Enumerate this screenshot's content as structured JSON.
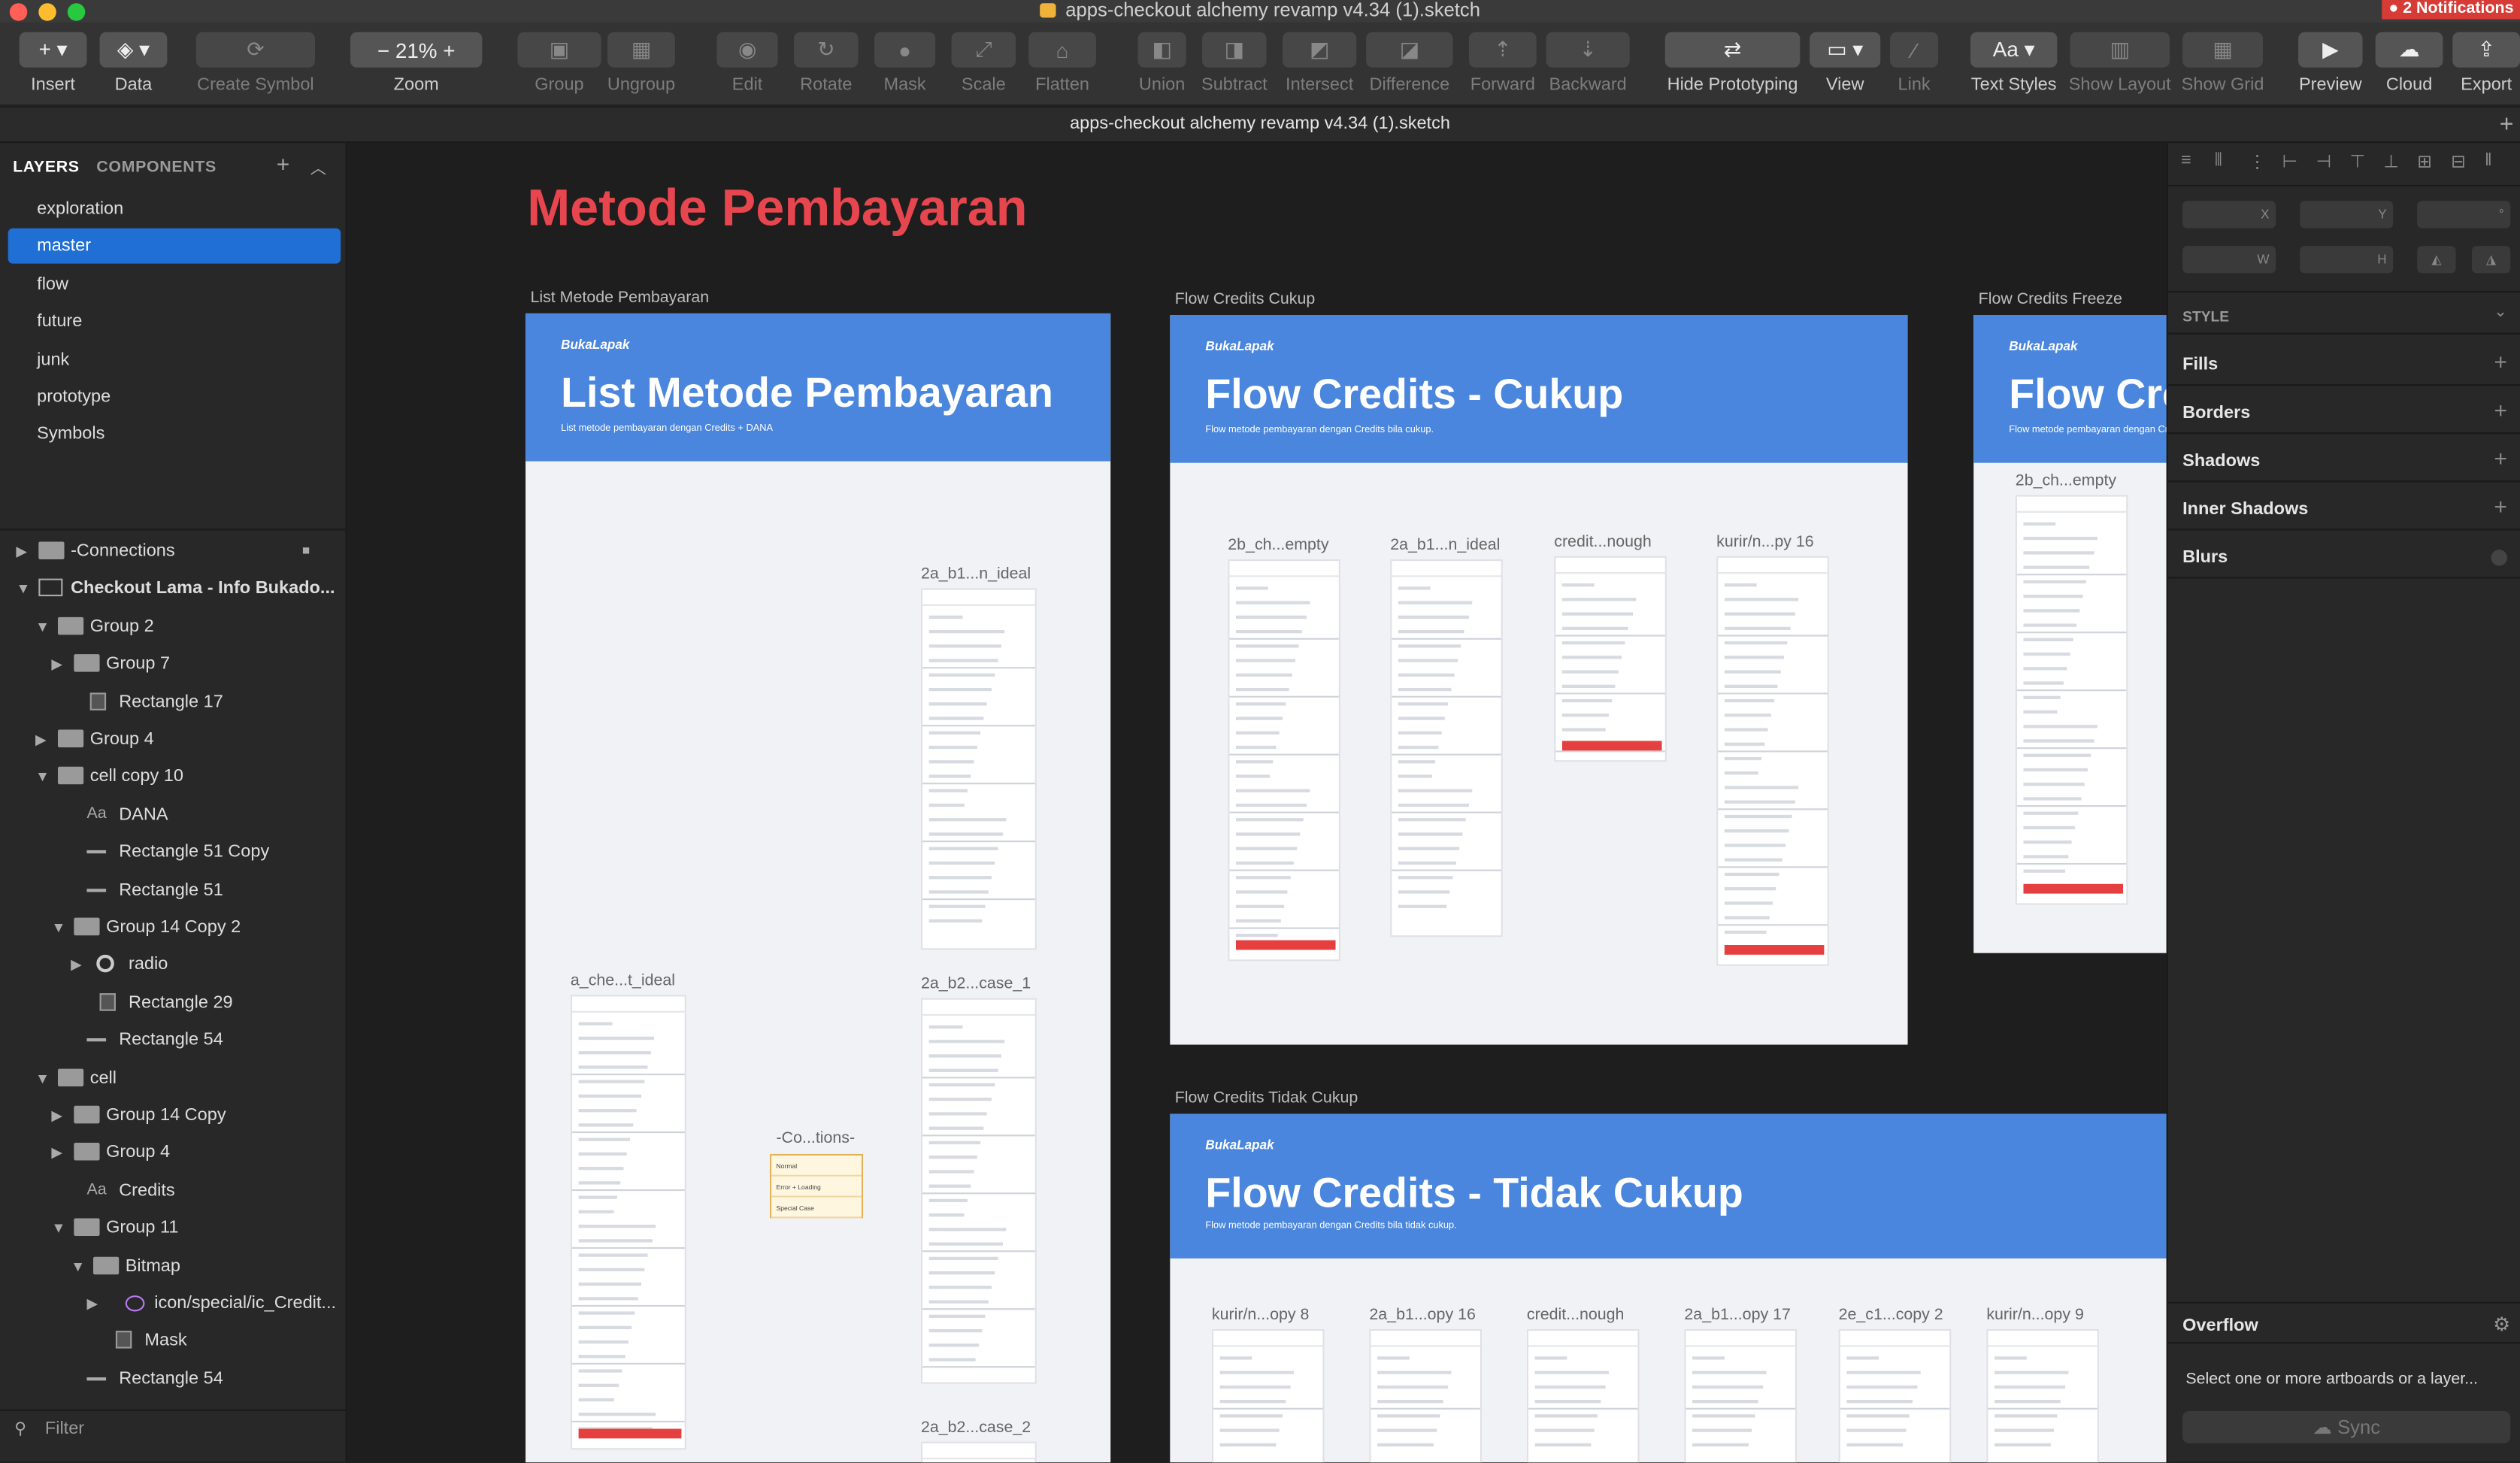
{
  "window": {
    "title": "apps-checkout alchemy revamp v4.34 (1).sketch",
    "notifications": "2 Notifications",
    "document_tab": "apps-checkout alchemy revamp v4.34 (1).sketch"
  },
  "toolbar": {
    "items": [
      {
        "label": "Insert",
        "icon": "+ ▾"
      },
      {
        "label": "Data",
        "icon": "◈ ▾"
      },
      {
        "label": "Create Symbol",
        "icon": "⟳"
      },
      {
        "label": "Zoom",
        "icon": "−  21%  +"
      },
      {
        "label": "Group",
        "icon": "▣"
      },
      {
        "label": "Ungroup",
        "icon": "▦"
      },
      {
        "label": "Edit",
        "icon": "◉"
      },
      {
        "label": "Rotate",
        "icon": "↻"
      },
      {
        "label": "Mask",
        "icon": "●"
      },
      {
        "label": "Scale",
        "icon": "⤢"
      },
      {
        "label": "Flatten",
        "icon": "⌂"
      },
      {
        "label": "Union",
        "icon": "◧"
      },
      {
        "label": "Subtract",
        "icon": "◨"
      },
      {
        "label": "Intersect",
        "icon": "◩"
      },
      {
        "label": "Difference",
        "icon": "◪"
      },
      {
        "label": "Forward",
        "icon": "⇡"
      },
      {
        "label": "Backward",
        "icon": "⇣"
      },
      {
        "label": "Hide Prototyping",
        "icon": "⇄"
      },
      {
        "label": "View",
        "icon": "▭ ▾"
      },
      {
        "label": "Link",
        "icon": "⁄"
      },
      {
        "label": "Text Styles",
        "icon": "Aa ▾"
      },
      {
        "label": "Show Layout",
        "icon": "▥"
      },
      {
        "label": "Show Grid",
        "icon": "▦"
      },
      {
        "label": "Preview",
        "icon": "▶"
      },
      {
        "label": "Cloud",
        "icon": "☁"
      },
      {
        "label": "Export",
        "icon": "⇪"
      }
    ]
  },
  "sidebar": {
    "tabs": [
      "LAYERS",
      "COMPONENTS"
    ],
    "pages": [
      "exploration",
      "master",
      "flow",
      "future",
      "junk",
      "prototype",
      "Symbols"
    ],
    "selected_page": "master",
    "layers": [
      {
        "label": "-Connections",
        "type": "folder",
        "arrow": "▶",
        "locked": true
      },
      {
        "label": "Checkout Lama - Info Bukado...",
        "type": "artboard",
        "arrow": "▼"
      },
      {
        "label": "Group 2",
        "type": "folder",
        "arrow": "▼"
      },
      {
        "label": "Group 7",
        "type": "folder",
        "arrow": "▶"
      },
      {
        "label": "Rectangle 17",
        "type": "rect",
        "arrow": ""
      },
      {
        "label": "Group 4",
        "type": "folder",
        "arrow": "▶"
      },
      {
        "label": "cell copy 10",
        "type": "folder",
        "arrow": "▼"
      },
      {
        "label": "DANA",
        "type": "text",
        "arrow": ""
      },
      {
        "label": "Rectangle 51 Copy",
        "type": "line",
        "arrow": ""
      },
      {
        "label": "Rectangle 51",
        "type": "line",
        "arrow": ""
      },
      {
        "label": "Group 14 Copy 2",
        "type": "folder",
        "arrow": "▼"
      },
      {
        "label": "radio",
        "type": "oval",
        "arrow": "▶"
      },
      {
        "label": "Rectangle 29",
        "type": "rect",
        "arrow": ""
      },
      {
        "label": "Rectangle 54",
        "type": "line",
        "arrow": ""
      },
      {
        "label": "cell",
        "type": "folder",
        "arrow": "▼"
      },
      {
        "label": "Group 14 Copy",
        "type": "folder",
        "arrow": "▶"
      },
      {
        "label": "Group 4",
        "type": "folder",
        "arrow": "▶"
      },
      {
        "label": "Credits",
        "type": "text",
        "arrow": ""
      },
      {
        "label": "Group 11",
        "type": "folder",
        "arrow": "▼"
      },
      {
        "label": "Bitmap",
        "type": "folder",
        "arrow": "▼"
      },
      {
        "label": "icon/special/ic_Credit...",
        "type": "symbol",
        "arrow": "▶"
      },
      {
        "label": "Mask",
        "type": "rect",
        "arrow": ""
      },
      {
        "label": "Rectangle 54",
        "type": "line",
        "arrow": ""
      }
    ],
    "filter_placeholder": "Filter"
  },
  "canvas": {
    "page_title": "Metode Pembayaran",
    "artboards": [
      {
        "label": "List Metode Pembayaran",
        "brand": "BukaLapak",
        "heading": "List Metode Pembayaran",
        "subheading": "List metode pembayaran dengan Credits + DANA",
        "screens": [
          "2a_b1...n_ideal",
          "a_che...t_ideal",
          "-Co...tions-",
          "2a_b2...case_1",
          "2a_b2...case_2"
        ],
        "variant_rows": [
          "Normal",
          "Error + Loading",
          "Special Case"
        ]
      },
      {
        "label": "Flow Credits Cukup",
        "brand": "BukaLapak",
        "heading": "Flow Credits - Cukup",
        "subheading": "Flow metode pembayaran dengan Credits bila cukup.",
        "screens": [
          "2b_ch...empty",
          "2a_b1...n_ideal",
          "credit...nough",
          "kurir/n...py 16"
        ]
      },
      {
        "label": "Flow Credits Freeze",
        "brand": "BukaLapak",
        "heading": "Flow Credits - Freeze",
        "subheading": "Flow metode pembayaran dengan Credits bila freeze.",
        "screens": [
          "2b_ch...empty"
        ]
      },
      {
        "label": "Flow Credits Tidak Cukup",
        "brand": "BukaLapak",
        "heading": "Flow Credits - Tidak Cukup",
        "subheading": "Flow metode pembayaran dengan Credits bila tidak cukup.",
        "screens": [
          "kurir/n...opy 8",
          "2a_b1...opy 16",
          "credit...nough",
          "2a_b1...opy 17",
          "2e_c1...copy 2",
          "kurir/n...opy 9"
        ]
      }
    ]
  },
  "inspector": {
    "field_labels": [
      "X",
      "Y",
      "°",
      "W",
      "H"
    ],
    "sections": [
      "STYLE",
      "Fills",
      "Borders",
      "Shadows",
      "Inner Shadows",
      "Blurs"
    ],
    "overflow_title": "Overflow",
    "overflow_text": "Select one or more artboards or a layer...",
    "sync_label": "Sync"
  },
  "colors": {
    "accent": "#1f6fd5",
    "header_blue": "#4a86dd",
    "title_red": "#e8464f",
    "cta_red": "#e53f3f"
  }
}
